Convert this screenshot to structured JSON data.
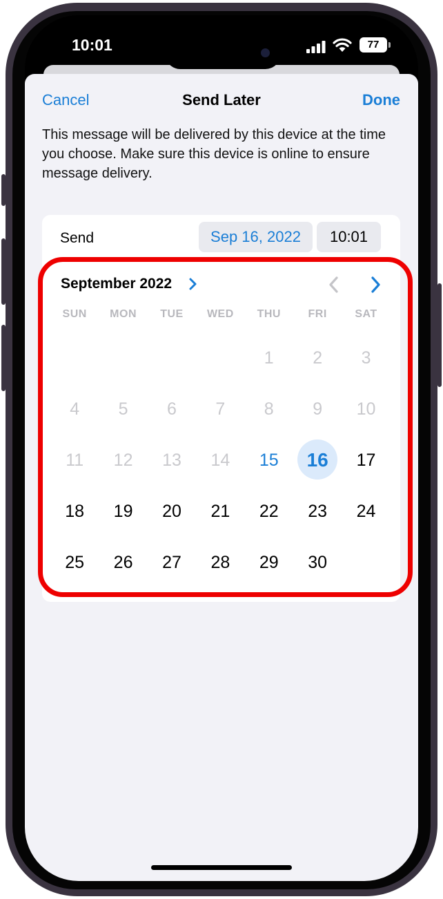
{
  "status_bar": {
    "time": "10:01",
    "battery": "77",
    "signal_icon": "cellular-signal-icon",
    "wifi_icon": "wifi-icon"
  },
  "nav": {
    "cancel_label": "Cancel",
    "title": "Send Later",
    "done_label": "Done"
  },
  "description": "This message will be delivered by this device at the time you choose. Make sure this device is online to ensure message delivery.",
  "send_row": {
    "label": "Send",
    "date": "Sep 16, 2022",
    "time": "10:01"
  },
  "calendar": {
    "month_title": "September 2022",
    "weekdays": [
      "SUN",
      "MON",
      "TUE",
      "WED",
      "THU",
      "FRI",
      "SAT"
    ],
    "weeks": [
      [
        "",
        "",
        "",
        "",
        "1",
        "2",
        "3"
      ],
      [
        "4",
        "5",
        "6",
        "7",
        "8",
        "9",
        "10"
      ],
      [
        "11",
        "12",
        "13",
        "14",
        "15",
        "16",
        "17"
      ],
      [
        "18",
        "19",
        "20",
        "21",
        "22",
        "23",
        "24"
      ],
      [
        "25",
        "26",
        "27",
        "28",
        "29",
        "30",
        ""
      ]
    ],
    "today": "15",
    "selected": "16",
    "past_days": [
      "1",
      "2",
      "3",
      "4",
      "5",
      "6",
      "7",
      "8",
      "9",
      "10",
      "11",
      "12",
      "13",
      "14"
    ]
  },
  "colors": {
    "accent": "#1a7ed6",
    "highlight_border": "#ee0000",
    "sheet_bg": "#f2f2f7",
    "disabled_text": "#c9c9cd"
  }
}
